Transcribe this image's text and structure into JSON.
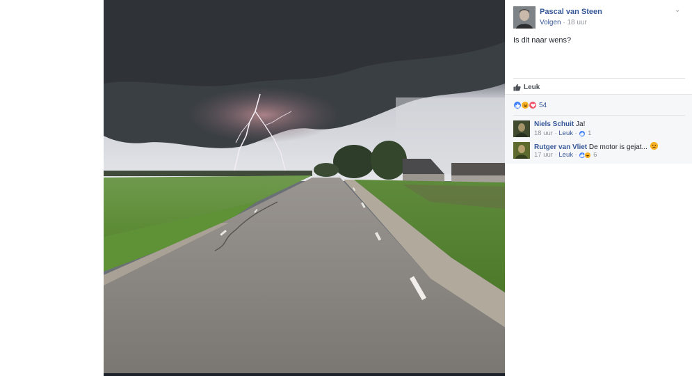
{
  "post": {
    "author": "Pascal van Steen",
    "follow_label": "Volgen",
    "separator": "·",
    "time": "18 uur",
    "text": "Is dit naar wens?",
    "chevron": "⌄"
  },
  "actions": {
    "like_label": "Leuk",
    "like_icon": "thumbs-up-icon"
  },
  "reactions": {
    "count": "54",
    "types": [
      "like",
      "haha",
      "love"
    ]
  },
  "comments": [
    {
      "name": "Niels Schuit",
      "text": "Ja!",
      "time": "18 uur",
      "separator": "·",
      "like_label": "Leuk",
      "separator2": "·",
      "reaction_count": "1"
    },
    {
      "name": "Rutger van Vliet",
      "text": "De motor is gejat...",
      "emoji": "sad",
      "time": "17 uur",
      "separator": "·",
      "like_label": "Leuk",
      "separator2": "·",
      "reaction_count": "6"
    }
  ],
  "colors": {
    "link": "#365899",
    "meta": "#90949c",
    "like_reaction": "#4080ff",
    "haha_reaction": "#f7b125",
    "love_reaction": "#f25268"
  }
}
